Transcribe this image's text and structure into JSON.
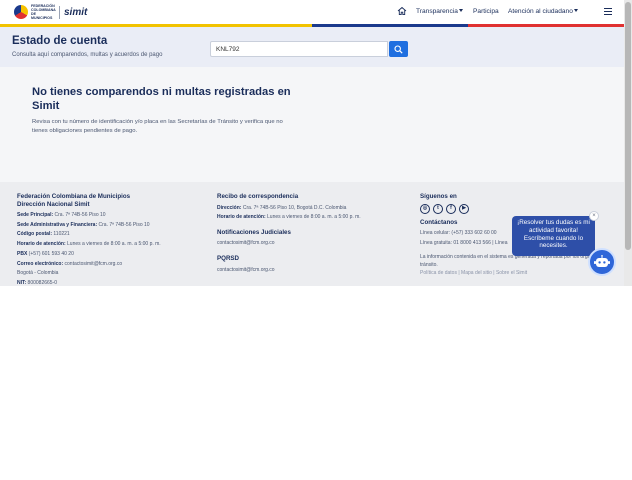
{
  "header": {
    "logo_text": "FEDERACIÓN COLOMBIANA DE MUNICIPIOS",
    "logo_brand": "simit",
    "nav": {
      "transparencia": "Transparencia",
      "participa": "Participa",
      "atencion": "Atención al ciudadano"
    },
    "icons": [
      "home-icon",
      "chevron-down-icon",
      "menu-icon"
    ]
  },
  "colors": {
    "stripe_yellow": "#f2c300",
    "stripe_blue": "#1b3a8c",
    "stripe_red": "#e03131",
    "accent": "#1f6fe0",
    "navy": "#1a2d5a"
  },
  "search_band": {
    "title": "Estado de cuenta",
    "subtitle": "Consulta aquí comparendos, multas y acuerdos de pago",
    "input_value": "KNL792"
  },
  "result": {
    "title": "No tienes comparendos ni multas registradas en Simit",
    "text": "Revisa con tu número de identificación y/o placa en las Secretarías de Tránsito y verifica que no tienes obligaciones pendientes de pago."
  },
  "footer": {
    "col1": {
      "title": "Federación Colombiana de Municipios",
      "subtitle": "Dirección Nacional Simit",
      "sede_principal_label": "Sede Principal:",
      "sede_principal": " Cra. 7ª 74B-56 Piso 10",
      "sede_admin_label": "Sede Administrativa y Financiera:",
      "sede_admin": " Cra. 7ª 74B-56 Piso 10",
      "codigo_label": "Código postal:",
      "codigo": " 110221",
      "horario_label": "Horario de atención:",
      "horario": " Lunes a viernes de 8:00 a. m. a 5:00 p. m.",
      "pbx_label": "PBX",
      "pbx": " (+57) 601 593 40 20",
      "correo_label": "Correo electrónico:",
      "correo": " contactosimit@fcm.org.co",
      "ciudad": "Bogotá - Colombia",
      "nit_label": "NIT:",
      "nit": " 800082665-0"
    },
    "col2": {
      "recibo_title": "Recibo de correspondencia",
      "direccion_label": "Dirección:",
      "direccion": " Cra. 7ª 74B-56 Piso 10, Bogotá D.C. Colombia",
      "horario_label": "Horario de atención:",
      "horario": " Lunes a viernes de 8:00 a. m. a 5:00 p. m.",
      "notif_title": "Notificaciones Judiciales",
      "notif_email": "contactosimit@fcm.org.co",
      "pqrsd_title": "PQRSD",
      "pqrsd_email": "contactosimit@fcm.org.co"
    },
    "col3": {
      "siguenos": "Síguenos en",
      "contactanos": "Contáctanos",
      "linea_celular": "Línea celular: (+57) 333 602 60 00",
      "linea_gratuita": "Línea gratuita: 01 8000 413 566 | Línea",
      "info": "La información contenida en el sistema es generada y reportada por los organismos de tránsito.",
      "links": "Política de datos | Mapa del sitio | Sobre el Simit"
    }
  },
  "chat": {
    "message": "¡Resolver tus dudas es mi actividad favorita! Escríbeme cuando lo necesites.",
    "close": "×"
  }
}
